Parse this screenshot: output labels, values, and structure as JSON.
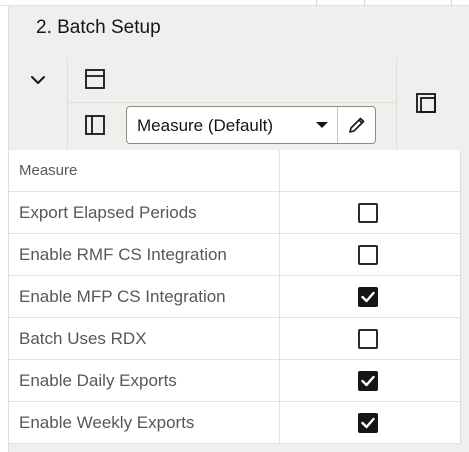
{
  "page": {
    "title": "2. Batch Setup"
  },
  "toolbar": {
    "view_select_value": "Measure (Default)"
  },
  "grid": {
    "header": "Measure",
    "rows": [
      {
        "label": "Export Elapsed Periods",
        "checked": false
      },
      {
        "label": "Enable RMF CS Integration",
        "checked": false
      },
      {
        "label": "Enable MFP CS Integration",
        "checked": true
      },
      {
        "label": "Batch Uses RDX",
        "checked": false
      },
      {
        "label": "Enable Daily Exports",
        "checked": true
      },
      {
        "label": "Enable Weekly Exports",
        "checked": true
      }
    ]
  }
}
